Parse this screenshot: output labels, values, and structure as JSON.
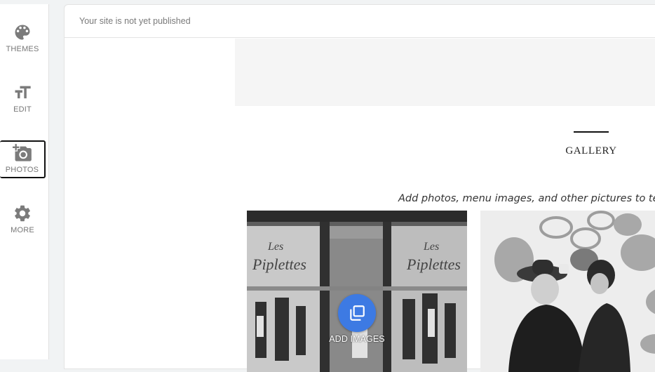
{
  "sidebar": {
    "items": [
      {
        "label": "THEMES",
        "icon": "palette-icon"
      },
      {
        "label": "EDIT",
        "icon": "text-size-icon"
      },
      {
        "label": "PHOTOS",
        "icon": "add-photo-icon",
        "active": true
      },
      {
        "label": "MORE",
        "icon": "gear-icon"
      }
    ]
  },
  "editor": {
    "status": "Your site is not yet published"
  },
  "gallery": {
    "title": "GALLERY",
    "subtitle": "Add photos, menu images, and other pictures to tell",
    "add_images_label": "ADD IMAGES",
    "photos": [
      {
        "sign_line1": "Les",
        "sign_line2": "Piplettes"
      },
      {
        "sign_line1": "Les",
        "sign_line2": "Piplettes"
      }
    ]
  },
  "colors": {
    "accent": "#3d7ae3",
    "rail_icon": "#757575",
    "active_outline": "#111111"
  }
}
